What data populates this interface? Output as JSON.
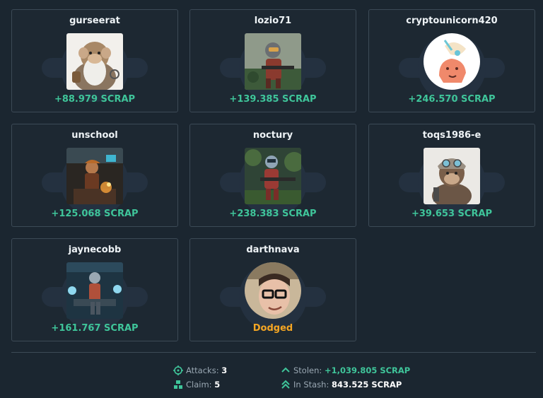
{
  "players": [
    {
      "name": "gurseerat",
      "result": "+88.979 SCRAP",
      "status": "stolen",
      "avatar": "monkey-wizard-icon"
    },
    {
      "name": "lozio71",
      "result": "+139.385 SCRAP",
      "status": "stolen",
      "avatar": "soldier-robot-icon"
    },
    {
      "name": "cryptounicorn420",
      "result": "+246.570 SCRAP",
      "status": "stolen",
      "avatar": "unicorn-icon"
    },
    {
      "name": "unschool",
      "result": "+125.068 SCRAP",
      "status": "stolen",
      "avatar": "workshop-welder-icon"
    },
    {
      "name": "noctury",
      "result": "+238.383 SCRAP",
      "status": "stolen",
      "avatar": "jungle-trooper-icon"
    },
    {
      "name": "toqs1986-e",
      "result": "+39.653 SCRAP",
      "status": "stolen",
      "avatar": "monkey-aviator-icon"
    },
    {
      "name": "jaynecobb",
      "result": "+161.767 SCRAP",
      "status": "stolen",
      "avatar": "hangar-mechanic-icon"
    },
    {
      "name": "darthnava",
      "result": "Dodged",
      "status": "dodged",
      "avatar": "person-glasses-icon"
    }
  ],
  "summary": {
    "attacks_label": "Attacks:",
    "attacks_value": "3",
    "claim_label": "Claim:",
    "claim_value": "5",
    "stolen_label": "Stolen:",
    "stolen_value": "+1,039.805 SCRAP",
    "stash_label": "In Stash:",
    "stash_value": "843.525 SCRAP"
  },
  "colors": {
    "background": "#1b2630",
    "card_border": "#3c4a56",
    "positive": "#3fc59a",
    "dodged": "#f5a623"
  }
}
